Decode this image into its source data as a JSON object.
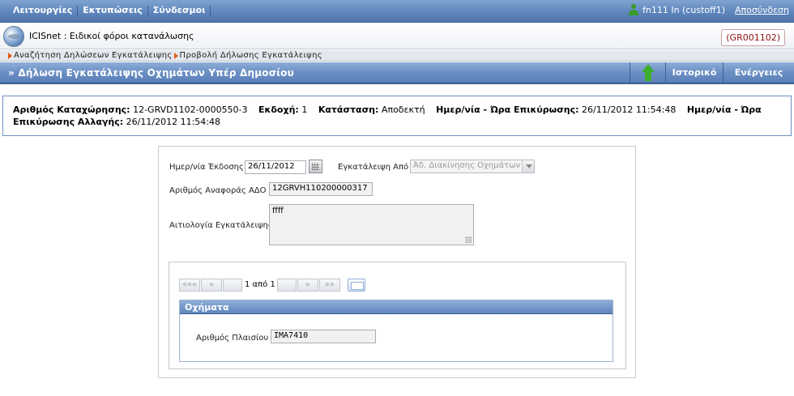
{
  "menu": {
    "items": [
      "Λειτουργίες",
      "Εκτυπώσεις",
      "Σύνδεσμοι"
    ],
    "user": "fn111 In (custoff1)",
    "logout": "Αποσύνδεση"
  },
  "app": {
    "title": "ICISnet : Ειδικοί φόροι κατανάλωσης",
    "tab_code": "(GR001102)"
  },
  "breadcrumbs": [
    "Αναζήτηση Δηλώσεων Εγκατάλειψης",
    "Προβολή Δήλωσης Εγκατάλειψης"
  ],
  "titlebar": {
    "title": "» Δήλωση Εγκατάλειψης Οχημάτων Υπέρ Δημοσίου",
    "history": "Ιστορικό",
    "actions": "Ενέργειες"
  },
  "info": {
    "reg_label": "Αριθμός Καταχώρησης:",
    "reg_value": "12-GRVD1102-0000550-3",
    "version_label": "Εκδοχή:",
    "version_value": "1",
    "status_label": "Κατάσταση:",
    "status_value": "Αποδεκτή",
    "confirm_label": "Ημερ/νία - Ώρα Επικύρωσης:",
    "confirm_value": "26/11/2012 11:54:48",
    "change_label_a": "Ημερ/νία -",
    "change_label_b": "Ώρα Επικύρωσης Αλλαγής:",
    "change_value": "26/11/2012 11:54:48"
  },
  "form": {
    "issue_date_label": "Ημερ/νία Έκδοσης",
    "issue_date_value": "26/11/2012",
    "abandon_from_label": "Εγκατάλειψη Από",
    "abandon_from_value": "Άδ. Διακίνησης Οχημάτων",
    "ado_label": "Αριθμός Αναφοράς ΑΔΟ",
    "ado_value": "12GRVH110200000317",
    "reason_label": "Αιτιολογία Εγκατάλειψης",
    "reason_value": "ffff"
  },
  "pager": {
    "first": "«««",
    "prev": "«",
    "info": "1 από 1",
    "next": "»",
    "last": "»»"
  },
  "vehicles": {
    "header": "Οχήματα",
    "chassis_label": "Αριθμός Πλαισίου",
    "chassis_value": "IMA7410"
  }
}
